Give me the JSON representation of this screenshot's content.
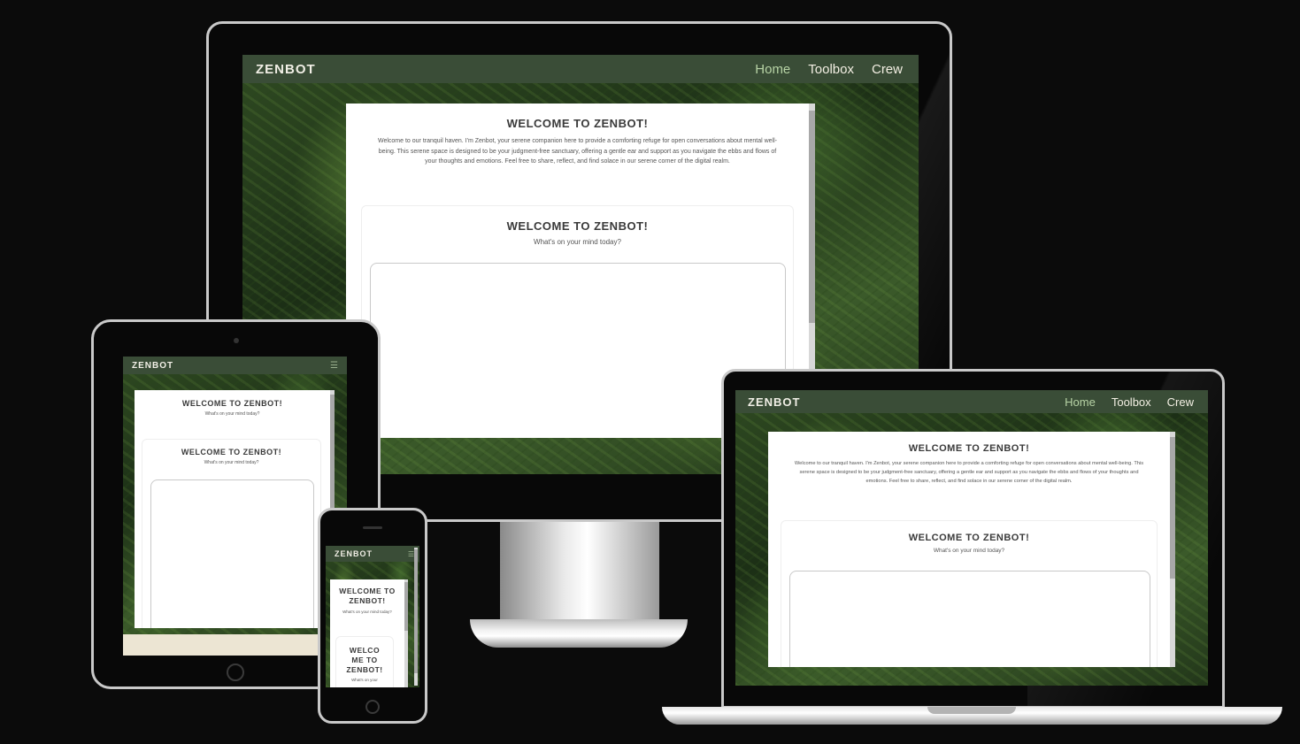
{
  "site": {
    "brand": "ZENBOT",
    "nav": {
      "home": "Home",
      "toolbox": "Toolbox",
      "crew": "Crew"
    },
    "menu_icon": "hamburger-icon",
    "welcome_title": "WELCOME TO ZENBOT!",
    "welcome_text": "Welcome to our tranquil haven. I'm Zenbot, your serene companion here to provide a comforting refuge for open conversations about mental well-being. This serene space is designed to be your judgment-free sanctuary, offering a gentle ear and support as you navigate the ebbs and flows of your thoughts and emotions. Feel free to share, reflect, and find solace in our serene corner of the digital realm.",
    "chat_title": "WELCOME TO ZENBOT!",
    "chat_prompt": "What's on your mind today?",
    "phone_title": "WELCOME TO ZENBOT!",
    "phone_title_narrow": "WELCO ME TO ZENBOT!",
    "phone_prompt": "What's on your"
  },
  "colors": {
    "nav": "#3a4d37",
    "active_link": "#b7d3a5",
    "background": "#0b0b0b"
  }
}
